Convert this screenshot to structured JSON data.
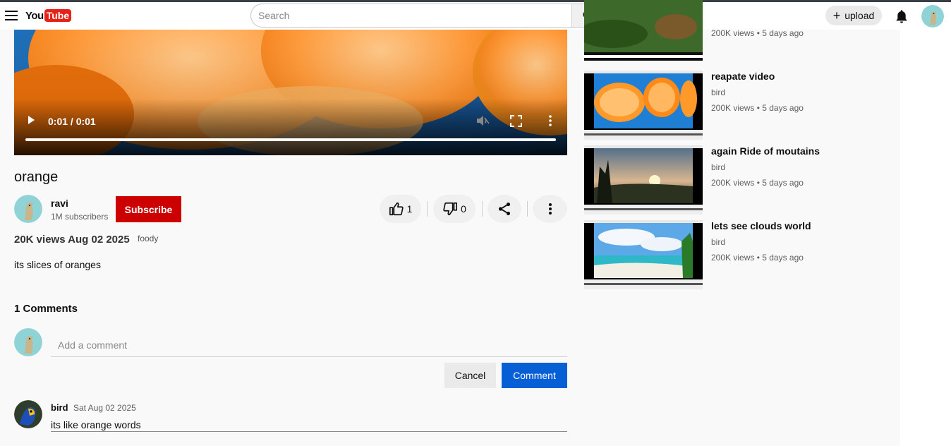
{
  "header": {
    "logo_you": "You",
    "logo_tube": "Tube",
    "search_placeholder": "Search",
    "upload_label": "upload"
  },
  "player": {
    "time": "0:01 / 0:01",
    "progress": 1.0
  },
  "video": {
    "title": "orange",
    "channel": "ravi",
    "subscribers": "1M subscribers",
    "subscribe_label": "Subscribe",
    "likes": "1",
    "dislikes": "0",
    "views_date": "20K views Aug 02 2025",
    "category": "foody",
    "description": "its slices of oranges"
  },
  "comments": {
    "heading": "1 Comments",
    "input_placeholder": "Add a comment",
    "cancel_label": "Cancel",
    "comment_label": "Comment",
    "items": [
      {
        "user": "bird",
        "date": "Sat Aug 02 2025",
        "text": "its like orange words"
      }
    ]
  },
  "recommendations": [
    {
      "title": "",
      "channel": "",
      "meta": "200K views • 5 days ago",
      "thumb": "forest"
    },
    {
      "title": "reapate video",
      "channel": "bird",
      "meta": "200K views • 5 days ago",
      "thumb": "orange"
    },
    {
      "title": "again Ride of moutains",
      "channel": "bird",
      "meta": "200K views • 5 days ago",
      "thumb": "sunset"
    },
    {
      "title": "lets see clouds world",
      "channel": "bird",
      "meta": "200K views • 5 days ago",
      "thumb": "beach"
    }
  ],
  "colors": {
    "subscribe": "#cc0000",
    "comment_button": "#065fd4",
    "logo_red": "#e62117"
  },
  "icons": [
    "menu-icon",
    "search-icon",
    "mic-icon",
    "plus-icon",
    "bell-icon",
    "play-icon",
    "volume-icon",
    "fullscreen-icon",
    "more-vert-icon",
    "thumbs-up-icon",
    "thumbs-down-icon",
    "share-icon"
  ]
}
